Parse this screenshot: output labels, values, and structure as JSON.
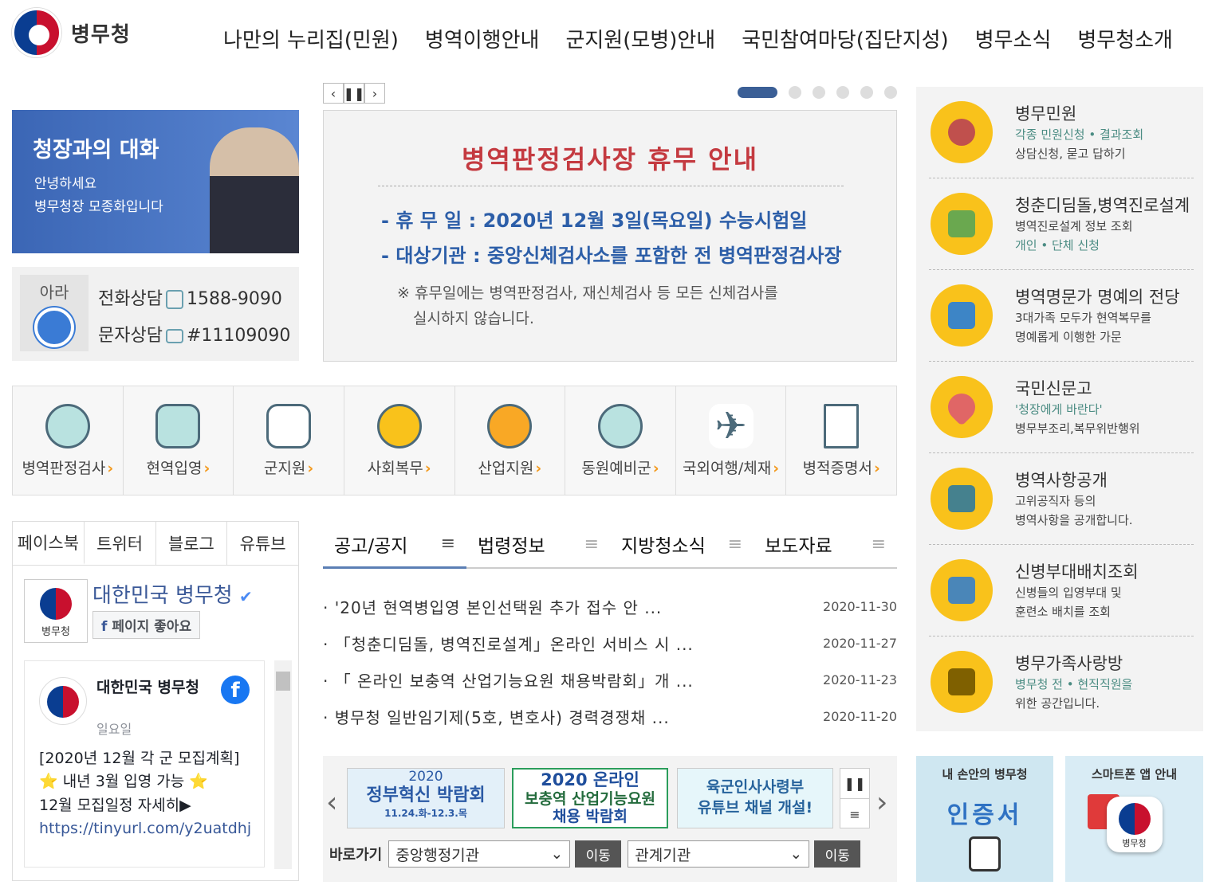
{
  "header": {
    "logo_text": "병무청",
    "nav": [
      "나만의 누리집(민원)",
      "병역이행안내",
      "군지원(모병)안내",
      "국민참여마당(집단지성)",
      "병무소식",
      "병무청소개"
    ]
  },
  "chief": {
    "title": "청장과의 대화",
    "line1": "안녕하세요",
    "line2": "병무청장 모종화입니다"
  },
  "consult": {
    "mascot_label": "아라",
    "phone_label": "전화상담",
    "phone_number": "1588-9090",
    "sms_label": "문자상담",
    "sms_number": "#11109090"
  },
  "slider": {
    "prev": "‹",
    "pause": "❚❚",
    "next": "›",
    "page_count": 6,
    "active_page": 1
  },
  "banner": {
    "title": "병역판정검사장 휴무 안내",
    "line1": "- 휴 무 일 : 2020년 12월 3일(목요일) 수능시험일",
    "line2": "- 대상기관 : 중앙신체검사소를 포함한 전 병역판정검사장",
    "note1": "※ 휴무일에는 병역판정검사, 재신체검사 등 모든 신체검사를",
    "note2": "실시하지 않습니다."
  },
  "quick_menu": [
    {
      "label": "병역판정검사",
      "icon": "checkup-person-icon"
    },
    {
      "label": "현역입영",
      "icon": "dog-tags-icon"
    },
    {
      "label": "군지원",
      "icon": "soldier-icon"
    },
    {
      "label": "사회복무",
      "icon": "mascot-icon"
    },
    {
      "label": "산업지원",
      "icon": "gear-icon"
    },
    {
      "label": "동원예비군",
      "icon": "badge-icon"
    },
    {
      "label": "국외여행/체재",
      "icon": "airplane-icon"
    },
    {
      "label": "병적증명서",
      "icon": "document-icon"
    }
  ],
  "sns": {
    "tabs": [
      "페이스북",
      "트위터",
      "블로그",
      "유튜브"
    ],
    "page_title": "대한민국 병무청",
    "page_logo_text": "병무청",
    "like_button": "페이지 좋아요",
    "post_author": "대한민국 병무청",
    "post_date": "일요일",
    "post_line1": "[2020년 12월 각 군 모집계획]",
    "post_line2": "⭐ 내년 3월 입영 가능 ⭐",
    "post_line3": "12월 모집일정 자세히▶",
    "post_link": "https://tinyurl.com/y2uatdhj"
  },
  "notice": {
    "tabs": [
      "공고/공지",
      "법령정보",
      "지방청소식",
      "보도자료"
    ],
    "more_icon": "≡",
    "items": [
      {
        "title": "'20년 현역병입영 본인선택원 추가 접수 안 ...",
        "date": "2020-11-30"
      },
      {
        "title": "「청춘디딤돌, 병역진로설계」온라인 서비스 시 ...",
        "date": "2020-11-27"
      },
      {
        "title": "「 온라인 보충역 산업기능요원 채용박람회」개 ...",
        "date": "2020-11-23"
      },
      {
        "title": "병무청 일반임기제(5호, 변호사) 경력경쟁채 ...",
        "date": "2020-11-20"
      }
    ]
  },
  "bottom_banners": {
    "b1_line1": "2020",
    "b1_line2": "정부혁신 박람회",
    "b1_line3": "11.24.화-12.3.목",
    "b2_line1": "2020 온라인",
    "b2_line2": "보충역 산업기능요원",
    "b2_line3": "채용 박람회",
    "b3_line1": "육군인사사령부",
    "b3_line2": "유튜브 채널 개설!",
    "pause": "❚❚",
    "menu": "≡",
    "prev": "‹",
    "next": "›",
    "shortcut_label": "바로가기",
    "select1": "중앙행정기관",
    "select2": "관계기관",
    "go_button": "이동"
  },
  "right_menu": [
    {
      "title": "병무민원",
      "sub1": "각종 민원신청 • 결과조회",
      "sub2": "상담신청, 묻고 답하기",
      "icon": "mascot-icon",
      "color": "#c0504d"
    },
    {
      "title": "청춘디딤돌,병역진로설계",
      "sub1": "병역진로설계 정보 조회",
      "sub2": "개인 • 단체 신청",
      "icon": "sprout-icon",
      "color": "#6aa84f"
    },
    {
      "title": "병역명문가 명예의 전당",
      "sub1": "3대가족 모두가 현역복무를",
      "sub2": "명예롭게 이행한 가문",
      "icon": "family-icon",
      "color": "#3d85c6"
    },
    {
      "title": "국민신문고",
      "sub1": "'청장에게 바란다'",
      "sub2": "병무부조리,복무위반행위",
      "icon": "heart-icon",
      "color": "#e06666"
    },
    {
      "title": "병역사항공개",
      "sub1": "고위공직자 등의",
      "sub2": "병역사항을 공개합니다.",
      "icon": "megaphone-icon",
      "color": "#45818e"
    },
    {
      "title": "신병부대배치조회",
      "sub1": "신병들의 입영부대 및",
      "sub2": "훈련소 배치를 조회",
      "icon": "map-pin-icon",
      "color": "#4a86b8"
    },
    {
      "title": "병무가족사랑방",
      "sub1": "병무청 전 • 현직직원을",
      "sub2": "위한 공간입니다.",
      "icon": "meeting-icon",
      "color": "#7f6000"
    }
  ],
  "right_banners": {
    "cert_title": "내 손안의 병무청",
    "cert_big": "인증서",
    "app_title": "스마트폰 앱 안내",
    "app_label": "병무청"
  }
}
